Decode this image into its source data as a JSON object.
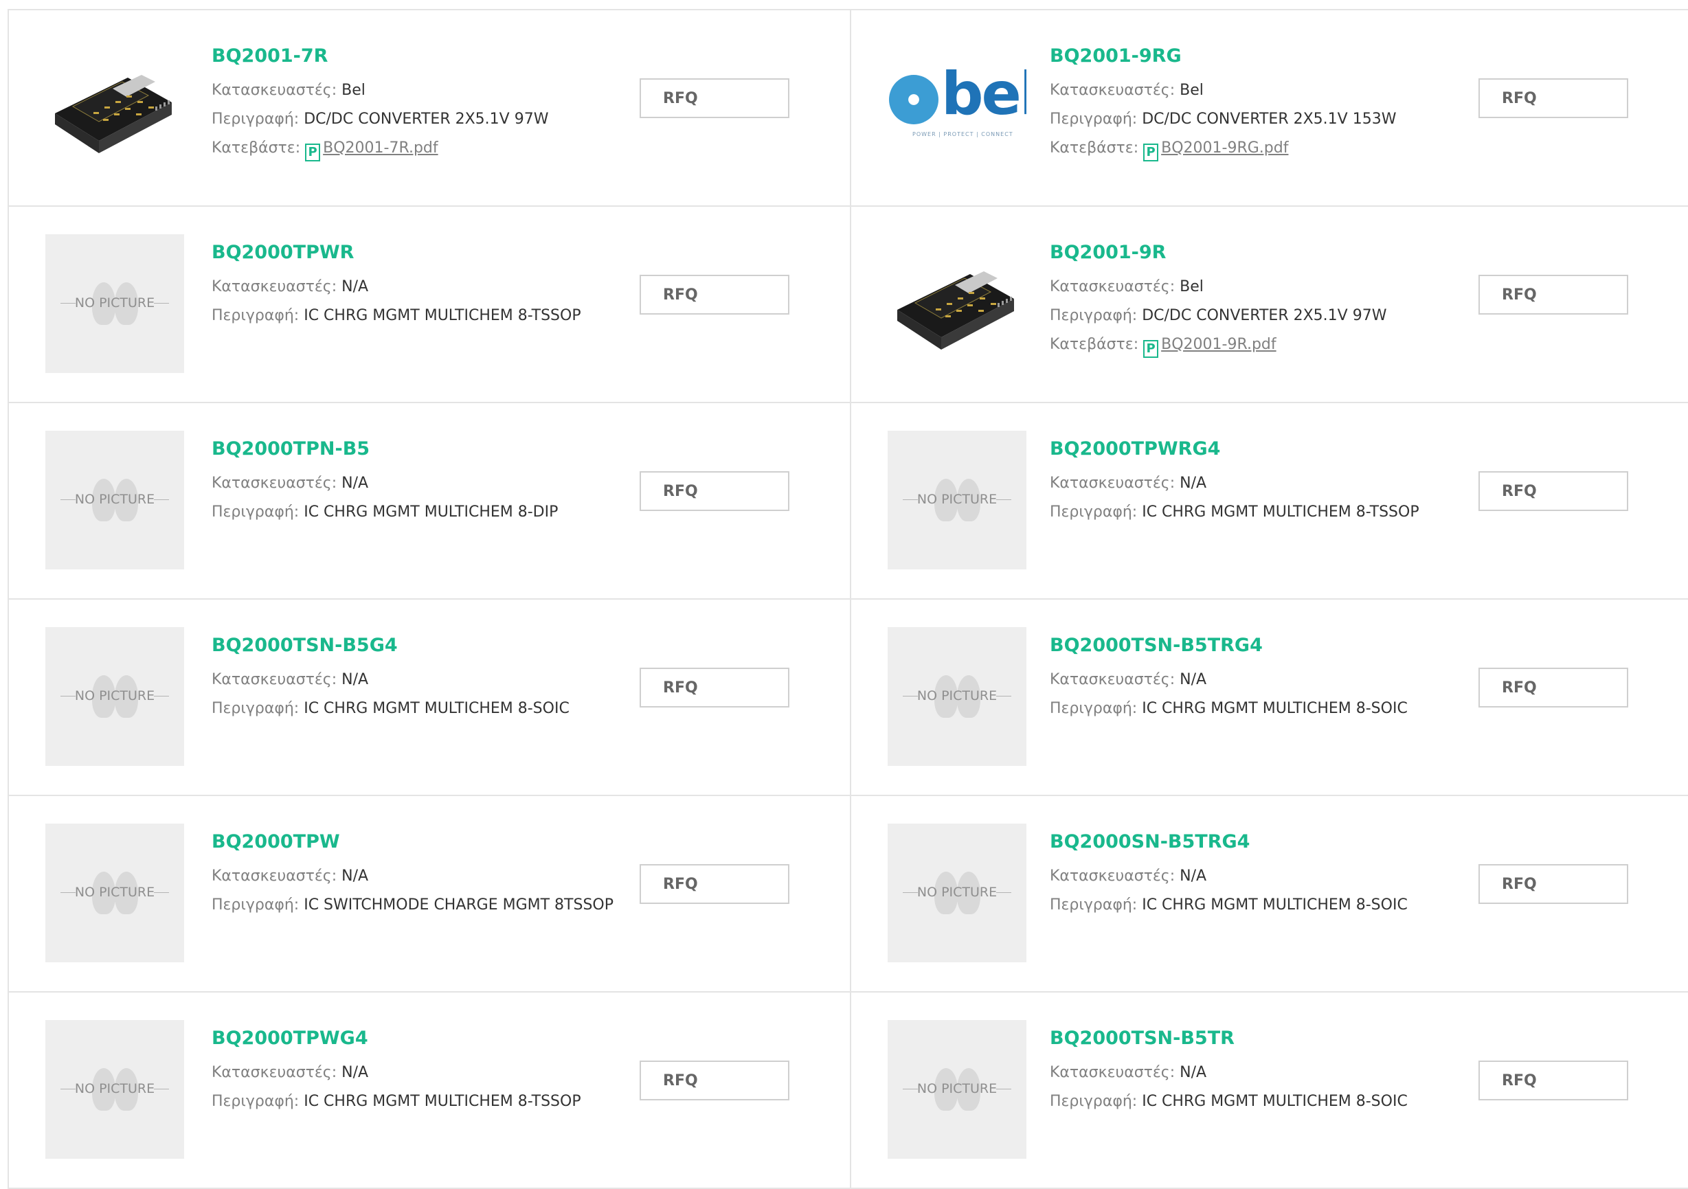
{
  "labels": {
    "manufacturer": "Κατασκευαστές:",
    "description": "Περιγραφή:",
    "download": "Κατεβάστε:",
    "no_picture": "NO PICTURE",
    "pdf_icon": "P"
  },
  "rfq_label": "RFQ",
  "colors": {
    "accent": "#19b88c",
    "border": "#e4e4e4",
    "placeholder_bg": "#eeeeee",
    "bel_blue": "#1f73b7"
  },
  "products": [
    {
      "part": "BQ2001-7R",
      "manufacturer": "Bel",
      "description": "DC/DC CONVERTER 2X5.1V 97W",
      "pdf": "BQ2001-7R.pdf",
      "image": "converter-module"
    },
    {
      "part": "BQ2001-9RG",
      "manufacturer": "Bel",
      "description": "DC/DC CONVERTER 2X5.1V 153W",
      "pdf": "BQ2001-9RG.pdf",
      "image": "bel-logo",
      "logo_text": "bel",
      "logo_tagline": "POWER | PROTECT | CONNECT"
    },
    {
      "part": "BQ2000TPWR",
      "manufacturer": "N/A",
      "description": "IC CHRG MGMT MULTICHEM 8-TSSOP",
      "image": "no-picture"
    },
    {
      "part": "BQ2001-9R",
      "manufacturer": "Bel",
      "description": "DC/DC CONVERTER 2X5.1V 97W",
      "pdf": "BQ2001-9R.pdf",
      "image": "converter-module"
    },
    {
      "part": "BQ2000TPN-B5",
      "manufacturer": "N/A",
      "description": "IC CHRG MGMT MULTICHEM 8-DIP",
      "image": "no-picture"
    },
    {
      "part": "BQ2000TPWRG4",
      "manufacturer": "N/A",
      "description": "IC CHRG MGMT MULTICHEM 8-TSSOP",
      "image": "no-picture"
    },
    {
      "part": "BQ2000TSN-B5G4",
      "manufacturer": "N/A",
      "description": "IC CHRG MGMT MULTICHEM 8-SOIC",
      "image": "no-picture"
    },
    {
      "part": "BQ2000TSN-B5TRG4",
      "manufacturer": "N/A",
      "description": "IC CHRG MGMT MULTICHEM 8-SOIC",
      "image": "no-picture"
    },
    {
      "part": "BQ2000TPW",
      "manufacturer": "N/A",
      "description": "IC SWITCHMODE CHARGE MGMT 8TSSOP",
      "image": "no-picture"
    },
    {
      "part": "BQ2000SN-B5TRG4",
      "manufacturer": "N/A",
      "description": "IC CHRG MGMT MULTICHEM 8-SOIC",
      "image": "no-picture"
    },
    {
      "part": "BQ2000TPWG4",
      "manufacturer": "N/A",
      "description": "IC CHRG MGMT MULTICHEM 8-TSSOP",
      "image": "no-picture"
    },
    {
      "part": "BQ2000TSN-B5TR",
      "manufacturer": "N/A",
      "description": "IC CHRG MGMT MULTICHEM 8-SOIC",
      "image": "no-picture"
    }
  ]
}
